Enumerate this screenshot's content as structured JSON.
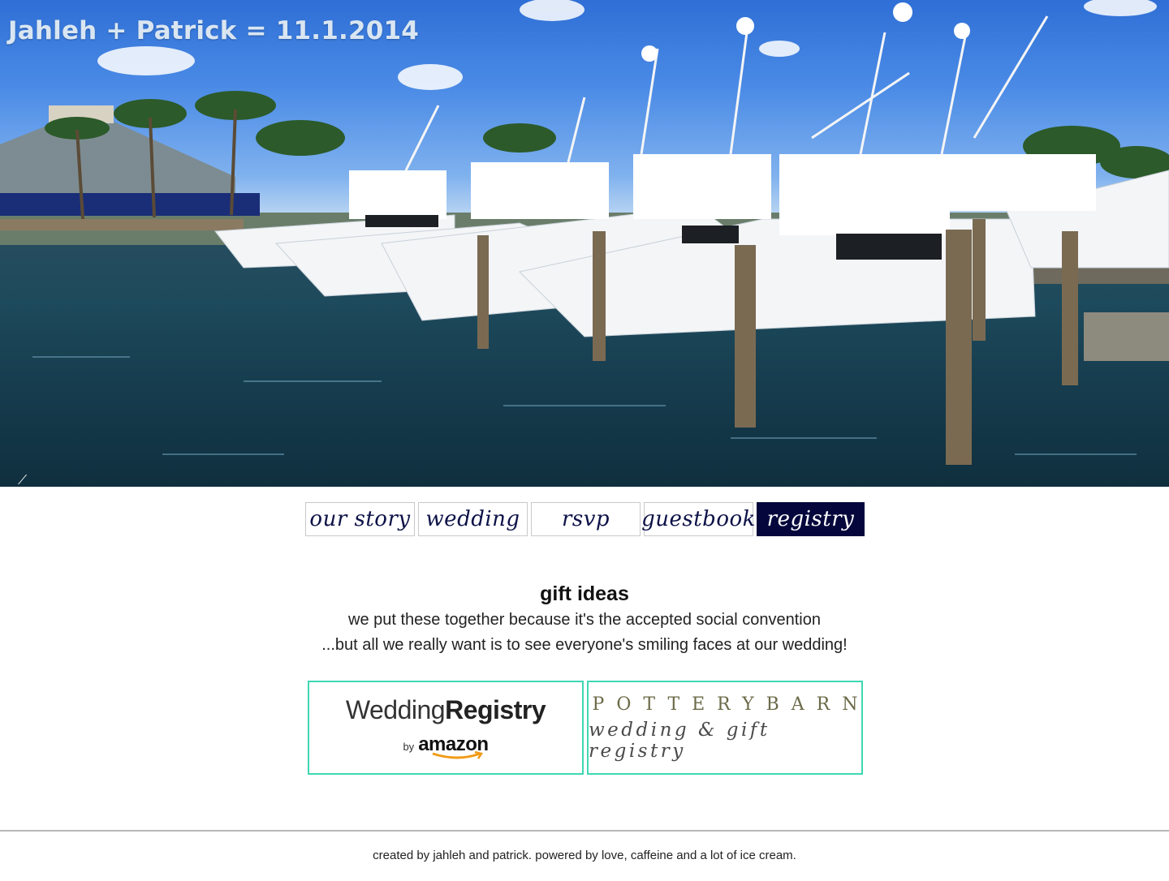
{
  "hero": {
    "title": "Jahleh + Patrick = 11.1.2014",
    "image": "marina-with-white-sport-fishing-boats"
  },
  "nav": {
    "items": [
      {
        "label": "our story",
        "active": false
      },
      {
        "label": "wedding",
        "active": false
      },
      {
        "label": "rsvp",
        "active": false
      },
      {
        "label": "guestbook",
        "active": false
      },
      {
        "label": "registry",
        "active": true
      }
    ]
  },
  "main": {
    "heading": "gift ideas",
    "line1": "we put these together because it's the accepted social convention",
    "line2": "...but all we really want is to see everyone's smiling faces at our wedding!"
  },
  "registries": {
    "amazon": {
      "word1": "Wedding",
      "word2": "Registry",
      "by": "by",
      "brand": "amazon"
    },
    "pottery_barn": {
      "top": "POTTERYBARN",
      "bottom": "wedding & gift registry"
    },
    "border_color": "#3fd7b3"
  },
  "footer": {
    "text": "created by jahleh and patrick. powered by love, caffeine and a lot of ice cream."
  },
  "colors": {
    "nav_active_bg": "#05073c",
    "nav_text": "#0c1147"
  }
}
